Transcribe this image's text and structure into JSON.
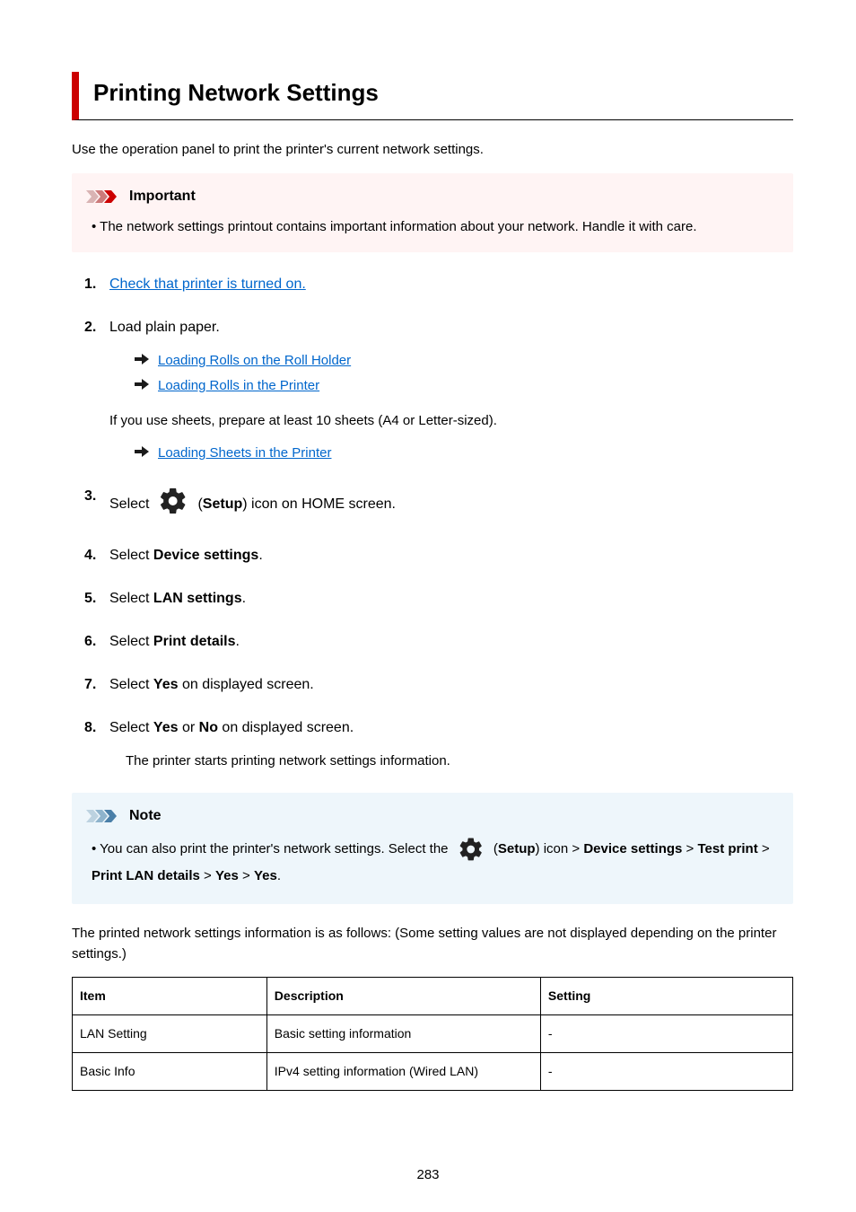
{
  "title": "Printing Network Settings",
  "intro": "Use the operation panel to print the printer's current network settings.",
  "important": {
    "label": "Important",
    "bullet": "The network settings printout contains important information about your network. Handle it with care."
  },
  "steps": {
    "s1": {
      "link": "Check that printer is turned on."
    },
    "s2": {
      "text": "Load plain paper.",
      "links": {
        "a": "Loading Rolls on the Roll Holder",
        "b": "Loading Rolls in the Printer"
      },
      "mid": "If you use sheets, prepare at least 10 sheets (A4 or Letter-sized).",
      "link_c": "Loading Sheets in the Printer"
    },
    "s3": {
      "pre": "Select",
      "post_open": " (",
      "setup": "Setup",
      "post_close": ") icon on HOME screen."
    },
    "s4": {
      "pre": "Select ",
      "bold": "Device settings",
      "post": "."
    },
    "s5": {
      "pre": "Select ",
      "bold": "LAN settings",
      "post": "."
    },
    "s6": {
      "pre": "Select ",
      "bold": "Print details",
      "post": "."
    },
    "s7": {
      "pre": "Select ",
      "bold": "Yes",
      "post": " on displayed screen."
    },
    "s8": {
      "pre": "Select ",
      "b1": "Yes",
      "mid": " or ",
      "b2": "No",
      "post": " on displayed screen.",
      "sub": "The printer starts printing network settings information."
    }
  },
  "note": {
    "label": "Note",
    "line_pre": "You can also print the printer's network settings. Select the ",
    "line_post_open": " (",
    "setup": "Setup",
    "line_post_close": ") icon > ",
    "b1": "Device settings",
    "gt1": " > ",
    "b2": "Test print",
    "gt2": " > ",
    "b3": "Print LAN details",
    "gt3": " > ",
    "b4": "Yes",
    "gt4": " > ",
    "b5": "Yes",
    "end": "."
  },
  "after_note": "The printed network settings information is as follows: (Some setting values are not displayed depending on the printer settings.)",
  "table": {
    "h1": "Item",
    "h2": "Description",
    "h3": "Setting",
    "r1c1": "LAN Setting",
    "r1c2": "Basic setting information",
    "r1c3": "-",
    "r2c1": "Basic Info",
    "r2c2": "IPv4 setting information (Wired LAN)",
    "r2c3": "-"
  },
  "page_number": "283"
}
